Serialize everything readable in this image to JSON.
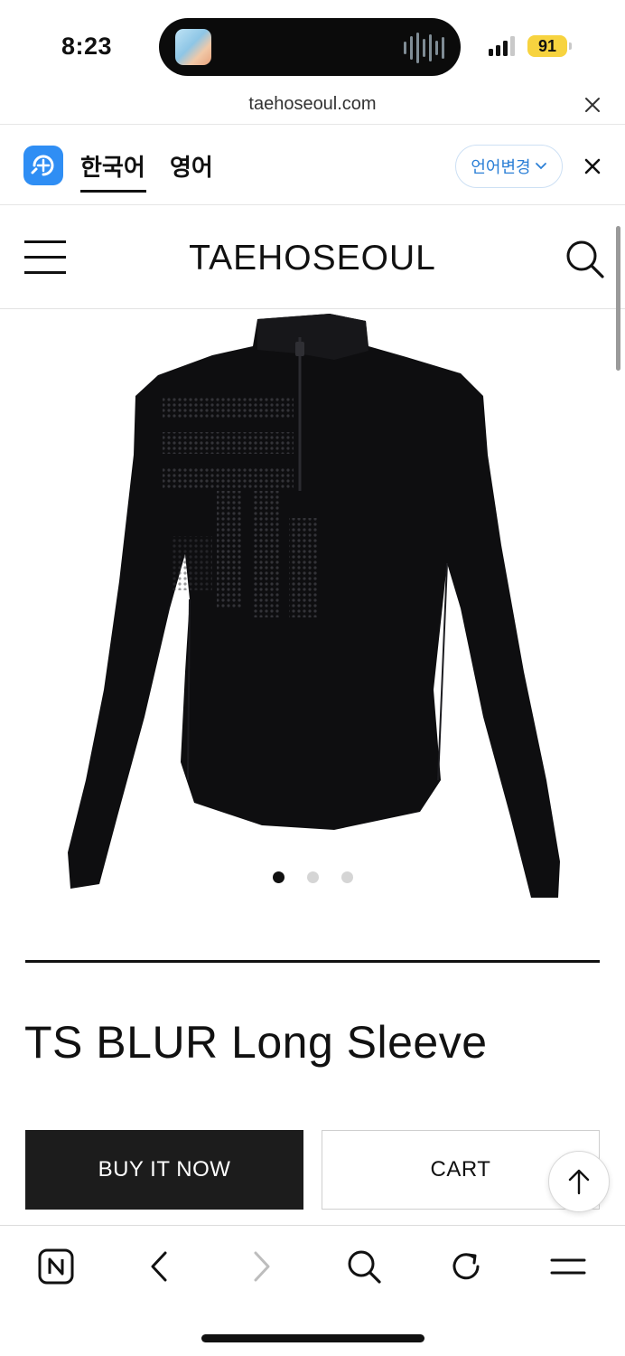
{
  "status_bar": {
    "time": "8:23",
    "battery": "91"
  },
  "browser": {
    "url": "taehoseoul.com"
  },
  "translate_bar": {
    "tab_source": "한국어",
    "tab_target": "영어",
    "change_language_label": "언어변경"
  },
  "site_header": {
    "brand": "TAEHOSEOUL"
  },
  "gallery": {
    "image_count": 3,
    "active_index": 0
  },
  "product": {
    "name": "TS BLUR Long Sleeve",
    "buy_label": "BUY IT NOW",
    "cart_label": "CART"
  },
  "toolbar_icons": [
    "naver-home-icon",
    "back-icon",
    "forward-icon",
    "search-icon",
    "reload-icon",
    "menu-icon"
  ],
  "colors": {
    "accent_blue": "#2f8ef4",
    "battery_yellow": "#f7d33f",
    "buy_button": "#1c1c1c"
  }
}
